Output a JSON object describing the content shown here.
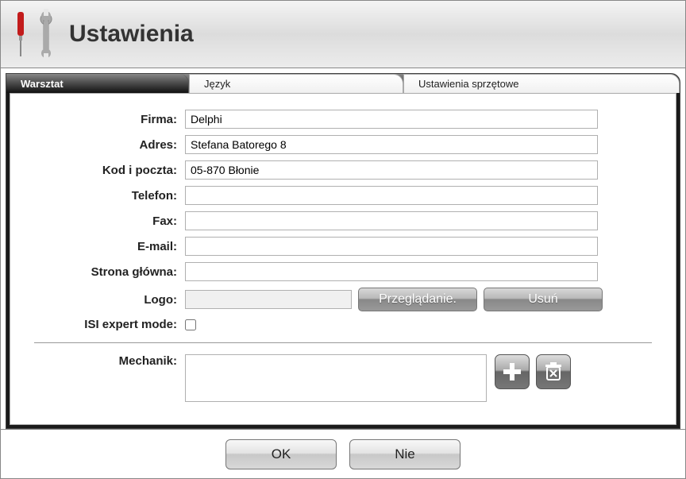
{
  "header": {
    "title": "Ustawienia"
  },
  "tabs": {
    "workshop": "Warsztat",
    "language": "Język",
    "hardware": "Ustawienia sprzętowe"
  },
  "form": {
    "labels": {
      "firma": "Firma:",
      "adres": "Adres:",
      "kod": "Kod i poczta:",
      "telefon": "Telefon:",
      "fax": "Fax:",
      "email": "E-mail:",
      "strona": "Strona główna:",
      "logo": "Logo:",
      "isi": "ISI expert mode:",
      "mechanik": "Mechanik:"
    },
    "values": {
      "firma": "Delphi",
      "adres": "Stefana Batorego 8",
      "kod": "05-870 Błonie",
      "telefon": "",
      "fax": "",
      "email": "",
      "strona": "",
      "logo": "",
      "isi_checked": false,
      "mechanik_list": []
    },
    "buttons": {
      "browse": "Przeglądanie.",
      "delete": "Usuń"
    }
  },
  "footer": {
    "ok": "OK",
    "cancel": "Nie"
  }
}
